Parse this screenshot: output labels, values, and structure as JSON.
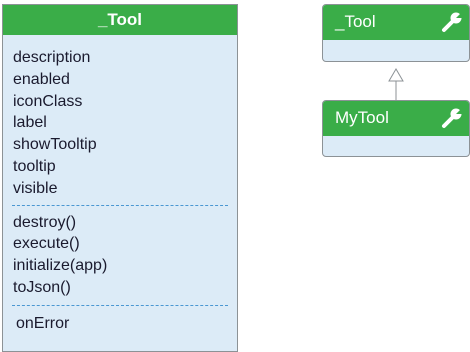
{
  "main_class": {
    "title": "_Tool",
    "properties": [
      "description",
      "enabled",
      "iconClass",
      "label",
      "showTooltip",
      "tooltip",
      "visible"
    ],
    "methods": [
      "destroy()",
      "execute()",
      "initialize(app)",
      "toJson()"
    ],
    "events": [
      "onError"
    ]
  },
  "hierarchy": {
    "parent": {
      "title": "_Tool",
      "icon": "wrench-icon"
    },
    "child": {
      "title": "MyTool",
      "icon": "wrench-icon"
    },
    "relation": "inherits"
  },
  "colors": {
    "header": "#3aad48",
    "body": "#dcebf7",
    "separator": "#4a97d2",
    "border": "#8c9296"
  }
}
